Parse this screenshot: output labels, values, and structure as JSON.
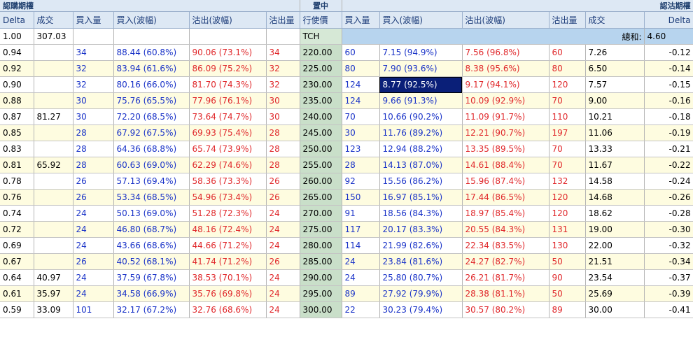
{
  "sections": {
    "calls": "認購期權",
    "center": "置中",
    "puts": "認沽期權"
  },
  "headers": {
    "call_delta": "Delta",
    "call_last": "成交",
    "call_bid_qty": "買入量",
    "call_bid": "買入(波幅)",
    "call_ask": "沽出(波幅)",
    "call_ask_qty": "沽出量",
    "strike": "行使價",
    "put_bid_qty": "買入量",
    "put_bid": "買入(波幅)",
    "put_ask": "沽出(波幅)",
    "put_ask_qty": "沽出量",
    "put_last": "成交",
    "put_delta": "Delta"
  },
  "underlying": {
    "delta": "1.00",
    "last": "307.03",
    "code": "TCH",
    "sum_label": "總和:",
    "sum_value": "4.60"
  },
  "selected_cell": "8.77 (92.5%)",
  "colors": {
    "header_bg": "#dde8f4",
    "strike_bg": "#c9dfc9",
    "alt_row_bg": "#fefce0",
    "bid": "#1a33c8",
    "ask": "#e0282b",
    "selected_bg": "#0a1f78"
  },
  "rows": [
    [
      "0.94",
      "",
      "34",
      "88.44 (60.8%)",
      "90.06 (73.1%)",
      "34",
      "220.00",
      "60",
      "7.15 (94.9%)",
      "7.56 (96.8%)",
      "60",
      "7.26",
      "-0.12"
    ],
    [
      "0.92",
      "",
      "32",
      "83.94 (61.6%)",
      "86.09 (75.2%)",
      "32",
      "225.00",
      "80",
      "7.90 (93.6%)",
      "8.38 (95.6%)",
      "80",
      "6.50",
      "-0.14"
    ],
    [
      "0.90",
      "",
      "32",
      "80.16 (66.0%)",
      "81.70 (74.3%)",
      "32",
      "230.00",
      "124",
      "8.77 (92.5%)",
      "9.17 (94.1%)",
      "120",
      "7.57",
      "-0.15"
    ],
    [
      "0.88",
      "",
      "30",
      "75.76 (65.5%)",
      "77.96 (76.1%)",
      "30",
      "235.00",
      "124",
      "9.66 (91.3%)",
      "10.09 (92.9%)",
      "70",
      "9.00",
      "-0.16"
    ],
    [
      "0.87",
      "81.27",
      "30",
      "72.20 (68.5%)",
      "73.64 (74.7%)",
      "30",
      "240.00",
      "70",
      "10.66 (90.2%)",
      "11.09 (91.7%)",
      "110",
      "10.21",
      "-0.18"
    ],
    [
      "0.85",
      "",
      "28",
      "67.92 (67.5%)",
      "69.93 (75.4%)",
      "28",
      "245.00",
      "30",
      "11.76 (89.2%)",
      "12.21 (90.7%)",
      "197",
      "11.06",
      "-0.19"
    ],
    [
      "0.83",
      "",
      "28",
      "64.36 (68.8%)",
      "65.74 (73.9%)",
      "28",
      "250.00",
      "123",
      "12.94 (88.2%)",
      "13.35 (89.5%)",
      "70",
      "13.33",
      "-0.21"
    ],
    [
      "0.81",
      "65.92",
      "28",
      "60.63 (69.0%)",
      "62.29 (74.6%)",
      "28",
      "255.00",
      "28",
      "14.13 (87.0%)",
      "14.61 (88.4%)",
      "70",
      "11.67",
      "-0.22"
    ],
    [
      "0.78",
      "",
      "26",
      "57.13 (69.4%)",
      "58.36 (73.3%)",
      "26",
      "260.00",
      "92",
      "15.56 (86.2%)",
      "15.96 (87.4%)",
      "132",
      "14.58",
      "-0.24"
    ],
    [
      "0.76",
      "",
      "26",
      "53.34 (68.5%)",
      "54.96 (73.4%)",
      "26",
      "265.00",
      "150",
      "16.97 (85.1%)",
      "17.44 (86.5%)",
      "120",
      "14.68",
      "-0.26"
    ],
    [
      "0.74",
      "",
      "24",
      "50.13 (69.0%)",
      "51.28 (72.3%)",
      "24",
      "270.00",
      "91",
      "18.56 (84.3%)",
      "18.97 (85.4%)",
      "120",
      "18.62",
      "-0.28"
    ],
    [
      "0.72",
      "",
      "24",
      "46.80 (68.7%)",
      "48.16 (72.4%)",
      "24",
      "275.00",
      "117",
      "20.17 (83.3%)",
      "20.55 (84.3%)",
      "131",
      "19.00",
      "-0.30"
    ],
    [
      "0.69",
      "",
      "24",
      "43.66 (68.6%)",
      "44.66 (71.2%)",
      "24",
      "280.00",
      "114",
      "21.99 (82.6%)",
      "22.34 (83.5%)",
      "130",
      "22.00",
      "-0.32"
    ],
    [
      "0.67",
      "",
      "26",
      "40.52 (68.1%)",
      "41.74 (71.2%)",
      "26",
      "285.00",
      "24",
      "23.84 (81.6%)",
      "24.27 (82.7%)",
      "50",
      "21.51",
      "-0.34"
    ],
    [
      "0.64",
      "40.97",
      "24",
      "37.59 (67.8%)",
      "38.53 (70.1%)",
      "24",
      "290.00",
      "24",
      "25.80 (80.7%)",
      "26.21 (81.7%)",
      "90",
      "23.54",
      "-0.37"
    ],
    [
      "0.61",
      "35.97",
      "24",
      "34.58 (66.9%)",
      "35.76 (69.8%)",
      "24",
      "295.00",
      "89",
      "27.92 (79.9%)",
      "28.38 (81.1%)",
      "50",
      "25.69",
      "-0.39"
    ],
    [
      "0.59",
      "33.09",
      "101",
      "32.17 (67.2%)",
      "32.76 (68.6%)",
      "24",
      "300.00",
      "22",
      "30.23 (79.4%)",
      "30.57 (80.2%)",
      "89",
      "30.00",
      "-0.41"
    ]
  ]
}
